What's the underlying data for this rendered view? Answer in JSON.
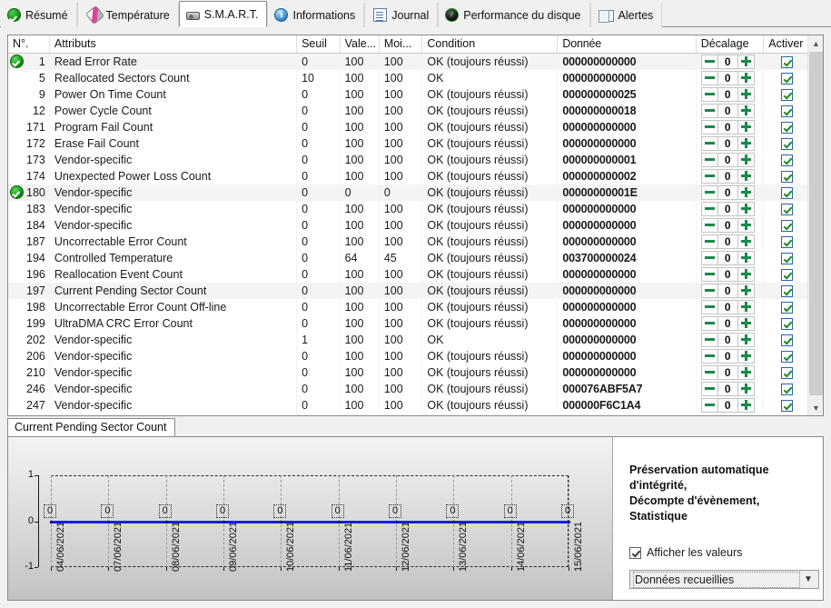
{
  "tabs": [
    {
      "label": "Résumé",
      "icon": "check-circle-icon",
      "active": false
    },
    {
      "label": "Température",
      "icon": "thermometer-icon",
      "active": false
    },
    {
      "label": "S.M.A.R.T.",
      "icon": "hdd-icon",
      "active": true
    },
    {
      "label": "Informations",
      "icon": "info-icon",
      "active": false
    },
    {
      "label": "Journal",
      "icon": "document-icon",
      "active": false
    },
    {
      "label": "Performance du disque",
      "icon": "gauge-icon",
      "active": false
    },
    {
      "label": "Alertes",
      "icon": "copy-icon",
      "active": false
    }
  ],
  "grid": {
    "columns": [
      "N°.",
      "Attributs",
      "Seuil",
      "Vale...",
      "Moi...",
      "Condition",
      "Donnée",
      "Décalage",
      "Activer"
    ],
    "rows": [
      {
        "status": "ok",
        "no": "1",
        "attr": "Read Error Rate",
        "seuil": "0",
        "value": "100",
        "min": "100",
        "condition": "OK (toujours réussi)",
        "data": "000000000000",
        "offset": "0",
        "enabled": true
      },
      {
        "status": "",
        "no": "5",
        "attr": "Reallocated Sectors Count",
        "seuil": "10",
        "value": "100",
        "min": "100",
        "condition": "OK",
        "data": "000000000000",
        "offset": "0",
        "enabled": true
      },
      {
        "status": "",
        "no": "9",
        "attr": "Power On Time Count",
        "seuil": "0",
        "value": "100",
        "min": "100",
        "condition": "OK (toujours réussi)",
        "data": "000000000025",
        "offset": "0",
        "enabled": true
      },
      {
        "status": "",
        "no": "12",
        "attr": "Power Cycle Count",
        "seuil": "0",
        "value": "100",
        "min": "100",
        "condition": "OK (toujours réussi)",
        "data": "000000000018",
        "offset": "0",
        "enabled": true
      },
      {
        "status": "",
        "no": "171",
        "attr": "Program Fail Count",
        "seuil": "0",
        "value": "100",
        "min": "100",
        "condition": "OK (toujours réussi)",
        "data": "000000000000",
        "offset": "0",
        "enabled": true
      },
      {
        "status": "",
        "no": "172",
        "attr": "Erase Fail Count",
        "seuil": "0",
        "value": "100",
        "min": "100",
        "condition": "OK (toujours réussi)",
        "data": "000000000000",
        "offset": "0",
        "enabled": true
      },
      {
        "status": "",
        "no": "173",
        "attr": "Vendor-specific",
        "seuil": "0",
        "value": "100",
        "min": "100",
        "condition": "OK (toujours réussi)",
        "data": "000000000001",
        "offset": "0",
        "enabled": true
      },
      {
        "status": "",
        "no": "174",
        "attr": "Unexpected Power Loss Count",
        "seuil": "0",
        "value": "100",
        "min": "100",
        "condition": "OK (toujours réussi)",
        "data": "000000000002",
        "offset": "0",
        "enabled": true
      },
      {
        "status": "ok",
        "no": "180",
        "attr": "Vendor-specific",
        "seuil": "0",
        "value": "0",
        "min": "0",
        "condition": "OK (toujours réussi)",
        "data": "00000000001E",
        "offset": "0",
        "enabled": true
      },
      {
        "status": "",
        "no": "183",
        "attr": "Vendor-specific",
        "seuil": "0",
        "value": "100",
        "min": "100",
        "condition": "OK (toujours réussi)",
        "data": "000000000000",
        "offset": "0",
        "enabled": true
      },
      {
        "status": "",
        "no": "184",
        "attr": "Vendor-specific",
        "seuil": "0",
        "value": "100",
        "min": "100",
        "condition": "OK (toujours réussi)",
        "data": "000000000000",
        "offset": "0",
        "enabled": true
      },
      {
        "status": "",
        "no": "187",
        "attr": "Uncorrectable Error Count",
        "seuil": "0",
        "value": "100",
        "min": "100",
        "condition": "OK (toujours réussi)",
        "data": "000000000000",
        "offset": "0",
        "enabled": true
      },
      {
        "status": "",
        "no": "194",
        "attr": "Controlled Temperature",
        "seuil": "0",
        "value": "64",
        "min": "45",
        "condition": "OK (toujours réussi)",
        "data": "003700000024",
        "offset": "0",
        "enabled": true
      },
      {
        "status": "",
        "no": "196",
        "attr": "Reallocation Event Count",
        "seuil": "0",
        "value": "100",
        "min": "100",
        "condition": "OK (toujours réussi)",
        "data": "000000000000",
        "offset": "0",
        "enabled": true
      },
      {
        "status": "",
        "no": "197",
        "attr": "Current Pending Sector Count",
        "seuil": "0",
        "value": "100",
        "min": "100",
        "condition": "OK (toujours réussi)",
        "data": "000000000000",
        "offset": "0",
        "enabled": true
      },
      {
        "status": "",
        "no": "198",
        "attr": "Uncorrectable Error Count Off-line",
        "seuil": "0",
        "value": "100",
        "min": "100",
        "condition": "OK (toujours réussi)",
        "data": "000000000000",
        "offset": "0",
        "enabled": true
      },
      {
        "status": "",
        "no": "199",
        "attr": "UltraDMA CRC Error Count",
        "seuil": "0",
        "value": "100",
        "min": "100",
        "condition": "OK (toujours réussi)",
        "data": "000000000000",
        "offset": "0",
        "enabled": true
      },
      {
        "status": "",
        "no": "202",
        "attr": "Vendor-specific",
        "seuil": "1",
        "value": "100",
        "min": "100",
        "condition": "OK",
        "data": "000000000000",
        "offset": "0",
        "enabled": true
      },
      {
        "status": "",
        "no": "206",
        "attr": "Vendor-specific",
        "seuil": "0",
        "value": "100",
        "min": "100",
        "condition": "OK (toujours réussi)",
        "data": "000000000000",
        "offset": "0",
        "enabled": true
      },
      {
        "status": "",
        "no": "210",
        "attr": "Vendor-specific",
        "seuil": "0",
        "value": "100",
        "min": "100",
        "condition": "OK (toujours réussi)",
        "data": "000000000000",
        "offset": "0",
        "enabled": true
      },
      {
        "status": "",
        "no": "246",
        "attr": "Vendor-specific",
        "seuil": "0",
        "value": "100",
        "min": "100",
        "condition": "OK (toujours réussi)",
        "data": "000076ABF5A7",
        "offset": "0",
        "enabled": true
      },
      {
        "status": "",
        "no": "247",
        "attr": "Vendor-specific",
        "seuil": "0",
        "value": "100",
        "min": "100",
        "condition": "OK (toujours réussi)",
        "data": "000000F6C1A4",
        "offset": "0",
        "enabled": true
      }
    ]
  },
  "bottom": {
    "tab_label": "Current Pending Sector Count",
    "description_line1": "Préservation automatique d'intégrité,",
    "description_line2": "Décompte d'évènement, Statistique",
    "show_values_label": "Afficher les valeurs",
    "show_values_checked": true,
    "combo_value": "Données recueillies"
  },
  "chart_data": {
    "type": "line",
    "title": "Current Pending Sector Count",
    "xlabel": "",
    "ylabel": "",
    "ylim": [
      -1,
      1
    ],
    "yticks": [
      "1",
      "0",
      "-1"
    ],
    "grid": true,
    "legend": false,
    "show_point_labels": true,
    "x": [
      "04/06/2021",
      "07/06/2021",
      "08/06/2021",
      "09/06/2021",
      "10/06/2021",
      "11/06/2021",
      "12/06/2021",
      "13/06/2021",
      "14/06/2021",
      "15/06/2021"
    ],
    "values": [
      0,
      0,
      0,
      0,
      0,
      0,
      0,
      0,
      0,
      0
    ],
    "point_labels": [
      "0",
      "0",
      "0",
      "0",
      "0",
      "0",
      "0",
      "0",
      "0",
      "0"
    ],
    "series_color": "#1a1aee"
  },
  "colors": {
    "accent_green": "#1a8a4a",
    "series_blue": "#1a1aee",
    "tab_active_bg": "#ffffff",
    "window_bg": "#f0f0f0"
  }
}
